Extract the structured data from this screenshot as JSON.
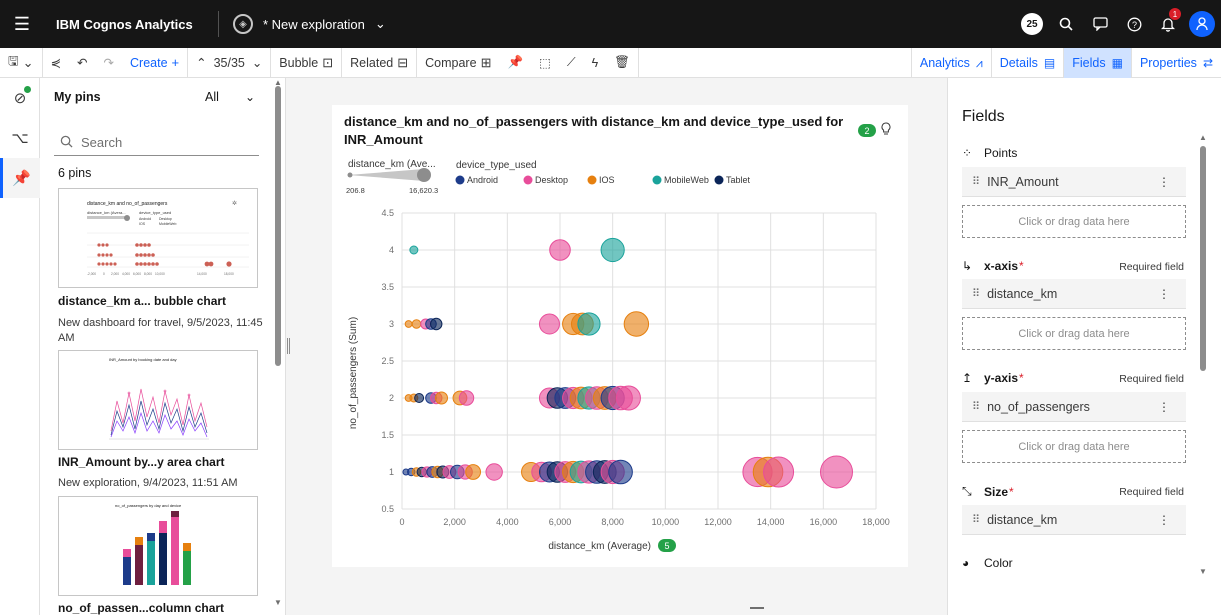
{
  "topbar": {
    "brand": "IBM Cognos Analytics",
    "exploration_title": "* New exploration",
    "badge_count": "25",
    "notification_count": "1"
  },
  "toolbar": {
    "create_label": "Create",
    "page_count": "35/35",
    "bubble_label": "Bubble",
    "related_label": "Related",
    "compare_label": "Compare",
    "right_tabs": {
      "analytics": "Analytics",
      "details": "Details",
      "fields": "Fields",
      "properties": "Properties"
    }
  },
  "pins": {
    "heading": "My pins",
    "filter_value": "All",
    "search_placeholder": "Search",
    "count_label": "6 pins",
    "items": [
      {
        "title": "distance_km a... bubble chart",
        "subtitle": "New dashboard for travel, 9/5/2023, 11:45 AM",
        "thumb_title": "distance_km and no_of_passengers",
        "thumb_legend": [
          "distance_km (Avera...",
          "device_type_used",
          "Android",
          "Desktop",
          "IOS",
          "MobileWeb"
        ],
        "thumb_ticks": [
          "-2,000",
          "0",
          "2,000",
          "4,000",
          "6,000",
          "8,000",
          "10,000",
          "14,000",
          "18,000"
        ]
      },
      {
        "title": "INR_Amount by...y area chart",
        "subtitle": "New exploration, 9/4/2023, 11:51 AM",
        "thumb_title": "INR_Amount by booking date and day"
      },
      {
        "title": "no_of_passen...column chart",
        "subtitle": "",
        "thumb_title": "no_of_passengers by day and device"
      }
    ]
  },
  "chart_data": {
    "type": "scatter",
    "title": "distance_km and no_of_passengers with distance_km and device_type_used for INR_Amount",
    "title_badge": "2",
    "xlabel": "distance_km (Average)",
    "xlabel_badge": "5",
    "ylabel": "no_of_passengers (Sum)",
    "xlim": [
      0,
      18000
    ],
    "ylim": [
      0.5,
      4.5
    ],
    "xticks": [
      "0",
      "2,000",
      "4,000",
      "6,000",
      "8,000",
      "10,000",
      "12,000",
      "14,000",
      "16,000",
      "18,000"
    ],
    "yticks": [
      "0.5",
      "1",
      "1.5",
      "2",
      "2.5",
      "3",
      "3.5",
      "4",
      "4.5"
    ],
    "grid": true,
    "legend_position": "top-left",
    "size_legend": {
      "label": "distance_km (Ave...",
      "min": "206.8",
      "max": "16,620.3"
    },
    "color_legend_title": "device_type_used",
    "series": [
      {
        "name": "Android",
        "color": "#1d3b8a"
      },
      {
        "name": "Desktop",
        "color": "#e84d9a"
      },
      {
        "name": "IOS",
        "color": "#e6800f"
      },
      {
        "name": "MobileWeb",
        "color": "#1aa39b"
      },
      {
        "name": "Tablet",
        "color": "#0b2558"
      }
    ],
    "points": [
      {
        "x": 450,
        "y": 4,
        "series": "MobileWeb",
        "size": 450
      },
      {
        "x": 6000,
        "y": 4,
        "series": "Desktop",
        "size": 6000
      },
      {
        "x": 8000,
        "y": 4,
        "series": "MobileWeb",
        "size": 8000
      },
      {
        "x": 250,
        "y": 3,
        "series": "IOS",
        "size": 250
      },
      {
        "x": 550,
        "y": 3,
        "series": "IOS",
        "size": 550
      },
      {
        "x": 900,
        "y": 3,
        "series": "Desktop",
        "size": 900
      },
      {
        "x": 1100,
        "y": 3,
        "series": "Android",
        "size": 1100
      },
      {
        "x": 1300,
        "y": 3,
        "series": "Tablet",
        "size": 1300
      },
      {
        "x": 5600,
        "y": 3,
        "series": "Desktop",
        "size": 5600
      },
      {
        "x": 6500,
        "y": 3,
        "series": "IOS",
        "size": 6500
      },
      {
        "x": 6850,
        "y": 3,
        "series": "IOS",
        "size": 6850
      },
      {
        "x": 7100,
        "y": 3,
        "series": "MobileWeb",
        "size": 7100
      },
      {
        "x": 8900,
        "y": 3,
        "series": "IOS",
        "size": 8900
      },
      {
        "x": 250,
        "y": 2,
        "series": "IOS",
        "size": 250
      },
      {
        "x": 450,
        "y": 2,
        "series": "IOS",
        "size": 450
      },
      {
        "x": 650,
        "y": 2,
        "series": "Tablet",
        "size": 650
      },
      {
        "x": 1100,
        "y": 2,
        "series": "Android",
        "size": 1100
      },
      {
        "x": 1300,
        "y": 2,
        "series": "Desktop",
        "size": 1300
      },
      {
        "x": 1500,
        "y": 2,
        "series": "IOS",
        "size": 1500
      },
      {
        "x": 2200,
        "y": 2,
        "series": "IOS",
        "size": 2200
      },
      {
        "x": 2450,
        "y": 2,
        "series": "Desktop",
        "size": 2450
      },
      {
        "x": 5600,
        "y": 2,
        "series": "Desktop",
        "size": 5600
      },
      {
        "x": 5900,
        "y": 2,
        "series": "Tablet",
        "size": 5900
      },
      {
        "x": 6200,
        "y": 2,
        "series": "Android",
        "size": 6200
      },
      {
        "x": 6500,
        "y": 2,
        "series": "Desktop",
        "size": 6500
      },
      {
        "x": 6800,
        "y": 2,
        "series": "IOS",
        "size": 6800
      },
      {
        "x": 7100,
        "y": 2,
        "series": "MobileWeb",
        "size": 7100
      },
      {
        "x": 7400,
        "y": 2,
        "series": "Desktop",
        "size": 7400
      },
      {
        "x": 7700,
        "y": 2,
        "series": "IOS",
        "size": 7700
      },
      {
        "x": 8000,
        "y": 2,
        "series": "Android",
        "size": 8000
      },
      {
        "x": 8300,
        "y": 2,
        "series": "Desktop",
        "size": 8300
      },
      {
        "x": 8600,
        "y": 2,
        "series": "Desktop",
        "size": 8600
      },
      {
        "x": 150,
        "y": 1,
        "series": "Android",
        "size": 150
      },
      {
        "x": 350,
        "y": 1,
        "series": "Android",
        "size": 350
      },
      {
        "x": 550,
        "y": 1,
        "series": "IOS",
        "size": 550
      },
      {
        "x": 750,
        "y": 1,
        "series": "Tablet",
        "size": 750
      },
      {
        "x": 950,
        "y": 1,
        "series": "Desktop",
        "size": 950
      },
      {
        "x": 1150,
        "y": 1,
        "series": "Android",
        "size": 1150
      },
      {
        "x": 1350,
        "y": 1,
        "series": "IOS",
        "size": 1350
      },
      {
        "x": 1550,
        "y": 1,
        "series": "Tablet",
        "size": 1550
      },
      {
        "x": 1800,
        "y": 1,
        "series": "Desktop",
        "size": 1800
      },
      {
        "x": 2100,
        "y": 1,
        "series": "Android",
        "size": 2100
      },
      {
        "x": 2400,
        "y": 1,
        "series": "Desktop",
        "size": 2400
      },
      {
        "x": 2700,
        "y": 1,
        "series": "IOS",
        "size": 2700
      },
      {
        "x": 3500,
        "y": 1,
        "series": "Desktop",
        "size": 3500
      },
      {
        "x": 4900,
        "y": 1,
        "series": "IOS",
        "size": 4900
      },
      {
        "x": 5300,
        "y": 1,
        "series": "Desktop",
        "size": 5300
      },
      {
        "x": 5600,
        "y": 1,
        "series": "Android",
        "size": 5600
      },
      {
        "x": 5900,
        "y": 1,
        "series": "Tablet",
        "size": 5900
      },
      {
        "x": 6200,
        "y": 1,
        "series": "Desktop",
        "size": 6200
      },
      {
        "x": 6500,
        "y": 1,
        "series": "IOS",
        "size": 6500
      },
      {
        "x": 6800,
        "y": 1,
        "series": "MobileWeb",
        "size": 6800
      },
      {
        "x": 7100,
        "y": 1,
        "series": "Desktop",
        "size": 7100
      },
      {
        "x": 7400,
        "y": 1,
        "series": "Android",
        "size": 7400
      },
      {
        "x": 7700,
        "y": 1,
        "series": "Tablet",
        "size": 7700
      },
      {
        "x": 8000,
        "y": 1,
        "series": "Desktop",
        "size": 8000
      },
      {
        "x": 8300,
        "y": 1,
        "series": "Android",
        "size": 8300
      },
      {
        "x": 13500,
        "y": 1,
        "series": "Desktop",
        "size": 13500
      },
      {
        "x": 13900,
        "y": 1,
        "series": "IOS",
        "size": 13900
      },
      {
        "x": 14300,
        "y": 1,
        "series": "Desktop",
        "size": 14300
      },
      {
        "x": 16500,
        "y": 1,
        "series": "Desktop",
        "size": 16500
      }
    ]
  },
  "fields_panel": {
    "title": "Fields",
    "drop_hint": "Click or drag data here",
    "required_label": "Required field",
    "points": {
      "label": "Points",
      "field": "INR_Amount"
    },
    "x_axis": {
      "label": "x-axis",
      "field": "distance_km"
    },
    "y_axis": {
      "label": "y-axis",
      "field": "no_of_passengers"
    },
    "size": {
      "label": "Size",
      "field": "distance_km"
    },
    "color": {
      "label": "Color"
    }
  },
  "icons": [
    "hamburger-icon",
    "exploration-icon",
    "search-icon",
    "chat-icon",
    "help-icon",
    "notification-icon",
    "user-avatar",
    "save-icon",
    "share-icon",
    "undo-icon",
    "redo-icon",
    "pin-icon",
    "select-icon",
    "trend-icon",
    "bolt-icon",
    "trash-icon",
    "lightbulb-icon"
  ]
}
